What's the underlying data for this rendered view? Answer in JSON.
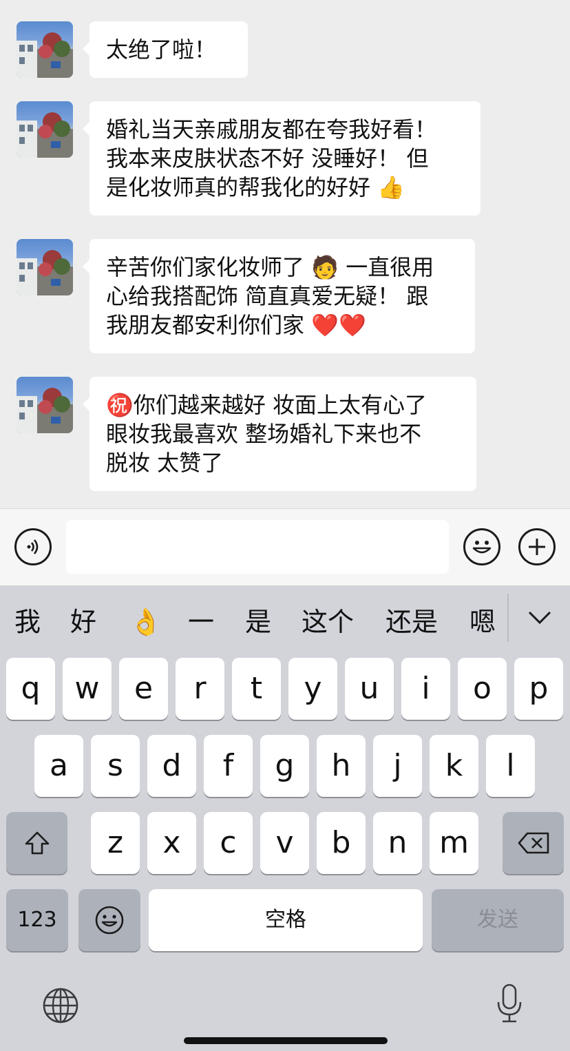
{
  "chat": {
    "messages": [
      {
        "lines": [
          "太绝了啦！"
        ]
      },
      {
        "lines": [
          "婚礼当天亲戚朋友都在夸我好看！",
          " 我本来皮肤状态不好 没睡好！ 但",
          "是化妆师真的帮我化的好好 👍"
        ]
      },
      {
        "lines": [
          "辛苦你们家化妆师了 🧑 一直很用",
          "心给我搭配饰 简直真爱无疑！ 跟",
          "我朋友都安利你们家 ❤️❤️"
        ]
      },
      {
        "lines": [
          "㊗️你们越来越好 妆面上太有心了",
          "眼妆我最喜欢 整场婚礼下来也不",
          "脱妆 太赞了"
        ]
      }
    ]
  },
  "input_bar": {
    "voice_icon": "voice-icon",
    "emoji_icon": "emoji-icon",
    "plus_icon": "plus-icon",
    "text_value": ""
  },
  "keyboard": {
    "candidates": [
      "我",
      "好",
      "👌",
      "一",
      "是",
      "这个",
      "还是",
      "嗯"
    ],
    "row1": [
      "q",
      "w",
      "e",
      "r",
      "t",
      "y",
      "u",
      "i",
      "o",
      "p"
    ],
    "row2": [
      "a",
      "s",
      "d",
      "f",
      "g",
      "h",
      "j",
      "k",
      "l"
    ],
    "row3": [
      "z",
      "x",
      "c",
      "v",
      "b",
      "n",
      "m"
    ],
    "numbers_label": "123",
    "space_label": "空格",
    "send_label": "发送",
    "shift_icon": "shift-icon",
    "delete_icon": "backspace-icon",
    "emoji_key_icon": "emoji-icon",
    "globe_icon": "globe-icon",
    "mic_icon": "microphone-icon",
    "collapse_icon": "chevron-down-icon"
  },
  "colors": {
    "background": "#ededed",
    "bubble": "#ffffff",
    "keyboard": "#d2d4da",
    "function_key": "#adb1ba"
  }
}
